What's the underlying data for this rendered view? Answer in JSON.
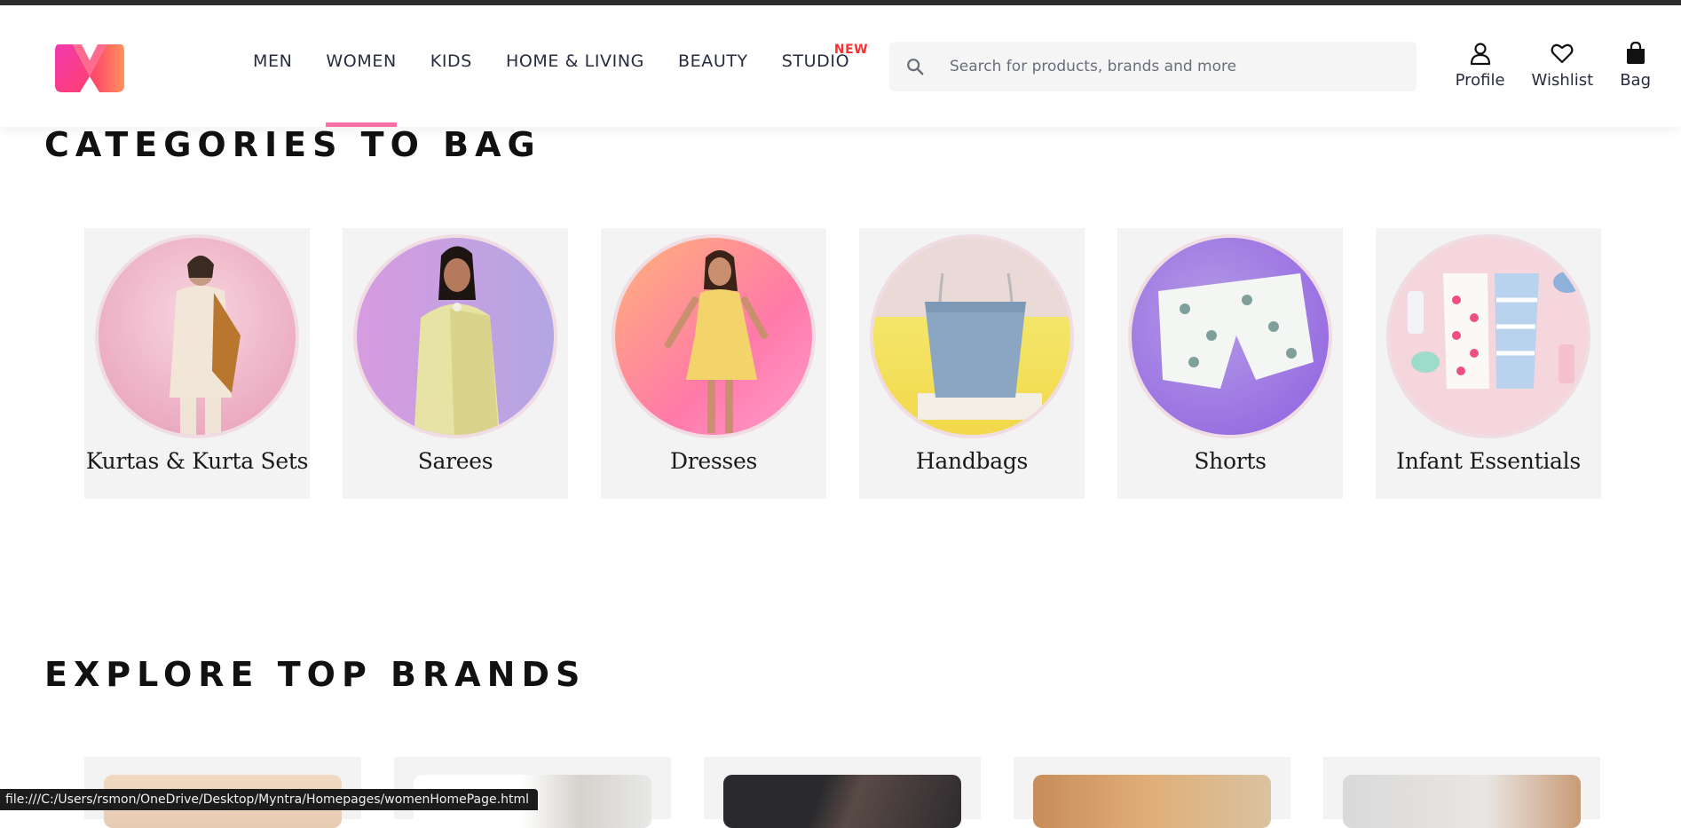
{
  "header": {
    "logo_alt": "Myntra",
    "nav": [
      {
        "label": "MEN",
        "active": false
      },
      {
        "label": "WOMEN",
        "active": true
      },
      {
        "label": "KIDS",
        "active": false
      },
      {
        "label": "HOME & LIVING",
        "active": false
      },
      {
        "label": "BEAUTY",
        "active": false
      },
      {
        "label": "STUDIO",
        "active": false,
        "badge": "NEW"
      }
    ],
    "search_placeholder": "Search for products, brands and more",
    "actions": [
      {
        "label": "Profile",
        "icon": "profile-icon"
      },
      {
        "label": "Wishlist",
        "icon": "heart-icon"
      },
      {
        "label": "Bag",
        "icon": "bag-icon"
      }
    ]
  },
  "categories": {
    "title": "CATEGORIES TO BAG",
    "items": [
      {
        "label": "Kurtas & Kurta Sets"
      },
      {
        "label": "Sarees"
      },
      {
        "label": "Dresses"
      },
      {
        "label": "Handbags"
      },
      {
        "label": "Shorts"
      },
      {
        "label": "Infant Essentials"
      }
    ]
  },
  "brands": {
    "title": "EXPLORE TOP BRANDS"
  },
  "status_bar": {
    "url": "file:///C:/Users/rsmon/OneDrive/Desktop/Myntra/Homepages/womenHomePage.html"
  },
  "colors": {
    "accent": "#ff6fa6",
    "new_badge": "#ff2e2e",
    "card_bg": "#f4f3f3"
  }
}
